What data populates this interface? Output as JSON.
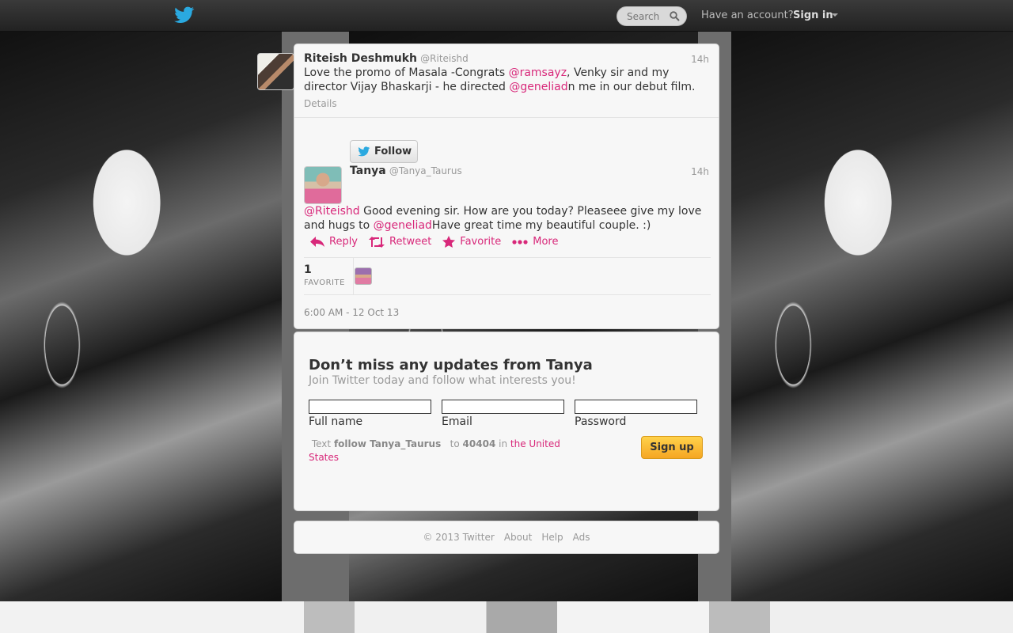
{
  "topbar": {
    "search_placeholder": "Search",
    "have_account": "Have an account?",
    "sign_in": "Sign in"
  },
  "parent_tweet": {
    "name": "Riteish Deshmukh",
    "handle": "@Riteishd",
    "time": "14h",
    "text_before": "Love the promo of Masala -Congrats ",
    "mention1": "@ramsayz",
    "text_mid": ", Venky sir and my director Vijay Bhaskarji - he directed ",
    "mention2": "@geneliad",
    "text_after": "n me in our debut film.",
    "details_label": "Details"
  },
  "main_tweet": {
    "follow_label": "Follow",
    "name": "Tanya",
    "handle": "@Tanya_Taurus",
    "time": "14h",
    "mention1": "@Riteishd",
    "text_mid": " Good evening sir. How are you today? Pleaseee give my love and hugs to ",
    "mention2": "@geneliad",
    "text_after": "Have great time my beautiful couple. :)",
    "actions": {
      "reply": "Reply",
      "retweet": "Retweet",
      "favorite": "Favorite",
      "more": "More"
    },
    "favorite_count": "1",
    "favorite_label": "FAVORITE",
    "datetime": "6:00 AM - 12 Oct 13"
  },
  "signup": {
    "title": "Don’t miss any updates from Tanya",
    "subtitle": "Join Twitter today and follow what interests you!",
    "full_name_label": "Full name",
    "email_label": "Email",
    "password_label": "Password",
    "sms_text": "Text",
    "sms_command": "follow Tanya_Taurus",
    "sms_to": "to",
    "sms_number": "40404",
    "sms_in": "in",
    "sms_country": "the United States",
    "signup_button": "Sign up"
  },
  "footer": {
    "copyright": "© 2013 Twitter",
    "about": "About",
    "help": "Help",
    "ads": "Ads"
  },
  "colors": {
    "accent": "#d8287a",
    "twitter_blue": "#2aa9e0",
    "signup_yellow": "#f5a623"
  }
}
